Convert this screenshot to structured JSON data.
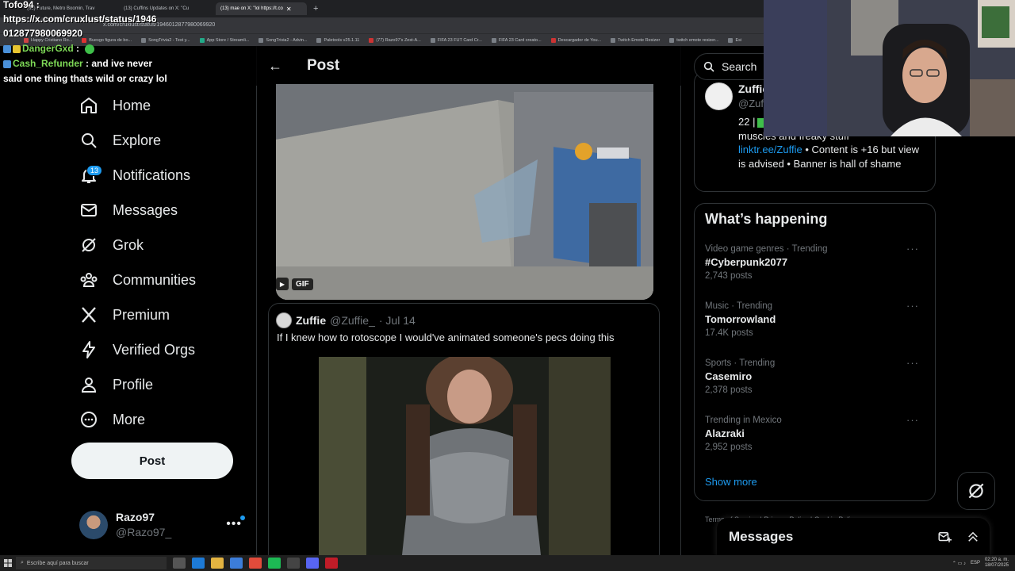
{
  "browser": {
    "tabs": [
      {
        "label": "(65) Future, Metro Boomin, Trav"
      },
      {
        "label": "(13) Cuffins Updates on X: \"Cu"
      },
      {
        "label": "(13) mae on X: \"lol https://t.co"
      }
    ],
    "new_tab_label": "+",
    "url": "x.com/cruxlust/status/1946012877980069920",
    "bookmarks": [
      "Happy Cristiano Ro...",
      "Buesgo figura de bo...",
      "SongTrivia2 - Test y...",
      "App Store / Streamli...",
      "SongTrivia2 - Advin...",
      "Paletools v25.1.11",
      "(77) Razo97's Zest-A...",
      "FIFA 23 FUT Card Cr...",
      "FIFA 23 Card creato...",
      "Descargador de You...",
      "Twitch Emote Resizer",
      "twitch emote resizer...",
      "Esi"
    ]
  },
  "overlay": {
    "top_user": "Tofo94 :",
    "url_line1": "https://x.com/cruxlust/status/1946",
    "url_line2": "012877980069920",
    "chat": [
      {
        "user": "DangerGxd",
        "sep": " :",
        "message": ""
      },
      {
        "user": "Cash_Refunder",
        "sep": " : ",
        "message": "and ive never"
      }
    ],
    "chat_continuation": "said one thing thats wild or crazy lol"
  },
  "nav": {
    "items": [
      {
        "label": "Home",
        "icon": "home-icon"
      },
      {
        "label": "Explore",
        "icon": "search-icon"
      },
      {
        "label": "Notifications",
        "icon": "bell-icon",
        "badge": "13"
      },
      {
        "label": "Messages",
        "icon": "mail-icon"
      },
      {
        "label": "Grok",
        "icon": "grok-icon"
      },
      {
        "label": "Communities",
        "icon": "communities-icon"
      },
      {
        "label": "Premium",
        "icon": "x-logo-icon"
      },
      {
        "label": "Verified Orgs",
        "icon": "lightning-icon"
      },
      {
        "label": "Profile",
        "icon": "person-icon"
      },
      {
        "label": "More",
        "icon": "more-circle-icon"
      }
    ],
    "post_button": "Post",
    "account": {
      "name": "Razo97",
      "handle": "@Razo97_",
      "more": "•••"
    }
  },
  "main": {
    "back_arrow": "←",
    "title": "Post",
    "gif_label": "GIF",
    "quote": {
      "name": "Zuffie",
      "handle": "@Zuffie_",
      "date": "· Jul 14",
      "text": "If I knew how to rotoscope I would've animated someone's pecs doing this"
    }
  },
  "right": {
    "search_placeholder": "Search",
    "profile": {
      "name": "Zuffie",
      "handle": "@Zuffie_",
      "bio_line1": "22 |",
      "bio_line2": "muscles and freaky stuff",
      "bio_link": "linktr.ee/Zuffie",
      "bio_rest": " • Content is +16 but view is advised • Banner is hall of shame"
    },
    "trends_title": "What’s happening",
    "trends": [
      {
        "category": "Video game genres · Trending",
        "name": "#Cyberpunk2077",
        "count": "2,743 posts"
      },
      {
        "category": "Music · Trending",
        "name": "Tomorrowland",
        "count": "17.4K posts"
      },
      {
        "category": "Sports · Trending",
        "name": "Casemiro",
        "count": "2,378 posts"
      },
      {
        "category": "Trending in Mexico",
        "name": "Alazraki",
        "count": "2,952 posts"
      }
    ],
    "trend_more": "···",
    "show_more": "Show more",
    "terms": "Terms of Service | Privacy Policy | Cookie Policy",
    "messages_title": "Messages"
  },
  "taskbar": {
    "search_placeholder": "Escribe aquí para buscar",
    "time": "02:20 a. m.",
    "date": "18/07/2025",
    "lang": "ESP"
  },
  "colors": {
    "accent": "#1d9bf0",
    "background": "#000000",
    "border": "#2f3336",
    "muted": "#71767b",
    "chat_name": "#7ed957"
  }
}
